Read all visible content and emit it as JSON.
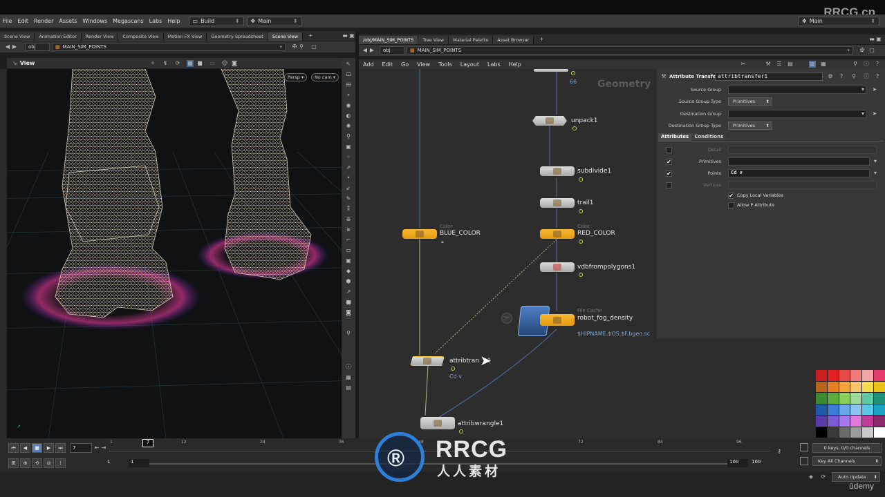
{
  "watermark_top": "RRCG.cn",
  "menubar": {
    "items": [
      "File",
      "Edit",
      "Render",
      "Assets",
      "Windows",
      "Megascans",
      "Labs",
      "Help"
    ],
    "desktop": "Build",
    "context": "Main",
    "right_context": "Main"
  },
  "left_pane": {
    "tabs": [
      "Scene View",
      "Animation Editor",
      "Render View",
      "Composite View",
      "Motion FX View",
      "Geometry Spreadsheet",
      "Scene View"
    ],
    "active_tab": 6,
    "path_root": "obj",
    "path_node": "MAIN_SIM_POINTS",
    "view_label": "View",
    "persp": "Persp",
    "cam": "No cam"
  },
  "right_pane": {
    "tabs": [
      "/obj/MAIN_SIM_POINTS",
      "Tree View",
      "Material Palette",
      "Asset Browser"
    ],
    "active_tab": 0,
    "path_root": "obj",
    "path_node": "MAIN_SIM_POINTS",
    "net_menu": [
      "Add",
      "Edit",
      "Go",
      "View",
      "Tools",
      "Layout",
      "Labs",
      "Help"
    ],
    "context_label": "Geometry"
  },
  "network": {
    "nodes": [
      {
        "id": "top",
        "label": "",
        "value": "66"
      },
      {
        "id": "unpack1",
        "label": "unpack1",
        "sub": ""
      },
      {
        "id": "subdivide1",
        "label": "subdivide1",
        "sub": ""
      },
      {
        "id": "trail1",
        "label": "trail1",
        "sub": ""
      },
      {
        "id": "blue",
        "label": "BLUE_COLOR",
        "sub": "Color"
      },
      {
        "id": "red",
        "label": "RED_COLOR",
        "sub": "Color"
      },
      {
        "id": "vdb",
        "label": "vdbfrompolygons1",
        "sub": ""
      },
      {
        "id": "cache",
        "label": "robot_fog_density",
        "sub": "File Cache",
        "value": "$HIPNAME.$OS.$F.bgeo.sc"
      },
      {
        "id": "attribtransfer",
        "label": "attribtran   :1",
        "value": "Cd v"
      },
      {
        "id": "wrangle",
        "label": "attribwrangle1",
        "sub": ""
      }
    ]
  },
  "params": {
    "type_label": "Attribute Transfer",
    "node_name": "attribtransfer1",
    "source_group_label": "Source Group",
    "source_group_type_label": "Source Group Type",
    "source_group_type": "Primitives",
    "dest_group_label": "Destination Group",
    "dest_group_type_label": "Destination Group Type",
    "dest_group_type": "Primitives",
    "tabs": [
      "Attributes",
      "Conditions"
    ],
    "rows": [
      {
        "label": "Detail",
        "checked": false,
        "value": ""
      },
      {
        "label": "Primitives",
        "checked": true,
        "value": ""
      },
      {
        "label": "Points",
        "checked": true,
        "value": "Cd  v"
      },
      {
        "label": "Vertices",
        "checked": false,
        "value": ""
      }
    ],
    "copy_local": "Copy Local Variables",
    "allow_p": "Allow P Attribute"
  },
  "timeline": {
    "frame": "7",
    "ticks": [
      "1",
      "12",
      "24",
      "36",
      "48",
      "60",
      "72",
      "84",
      "96"
    ],
    "start": "1",
    "start2": "1",
    "end": "100",
    "end2": "100",
    "keys_info": "0 keys, 0/0 channels",
    "key_all": "Key All Channels",
    "auto_update": "Auto Update"
  },
  "branding": {
    "rrcg": "RRCG",
    "rrcg_cn": "人人素材",
    "udemy": "ūdemy"
  },
  "colors": {
    "node_gold": "#f2a71e",
    "node_gray": "#c8c8c8",
    "wire": "#4a6fa5",
    "accent": "#7fa7d8"
  },
  "palette": [
    "#c91f1f",
    "#e02020",
    "#e84a4a",
    "#f07a7a",
    "#f4a6a6",
    "#e23b6b",
    "#b8641a",
    "#e67e22",
    "#f2a53a",
    "#f5c46b",
    "#f7d94c",
    "#e9c21a",
    "#3c8a2e",
    "#5aac3c",
    "#8ccf5a",
    "#9fd99a",
    "#5cc8a4",
    "#1e8f7a",
    "#1e5aa8",
    "#3a7bd5",
    "#6aa5e8",
    "#8fc3f2",
    "#5ac8e8",
    "#1aa3c2",
    "#5a3ca8",
    "#7a5ad5",
    "#a37ae8",
    "#e07ad8",
    "#c23a9a",
    "#8a2a6a",
    "#000000",
    "#3a3a3a",
    "#6a6a6a",
    "#9a9a9a",
    "#cacaca",
    "#ffffff"
  ]
}
